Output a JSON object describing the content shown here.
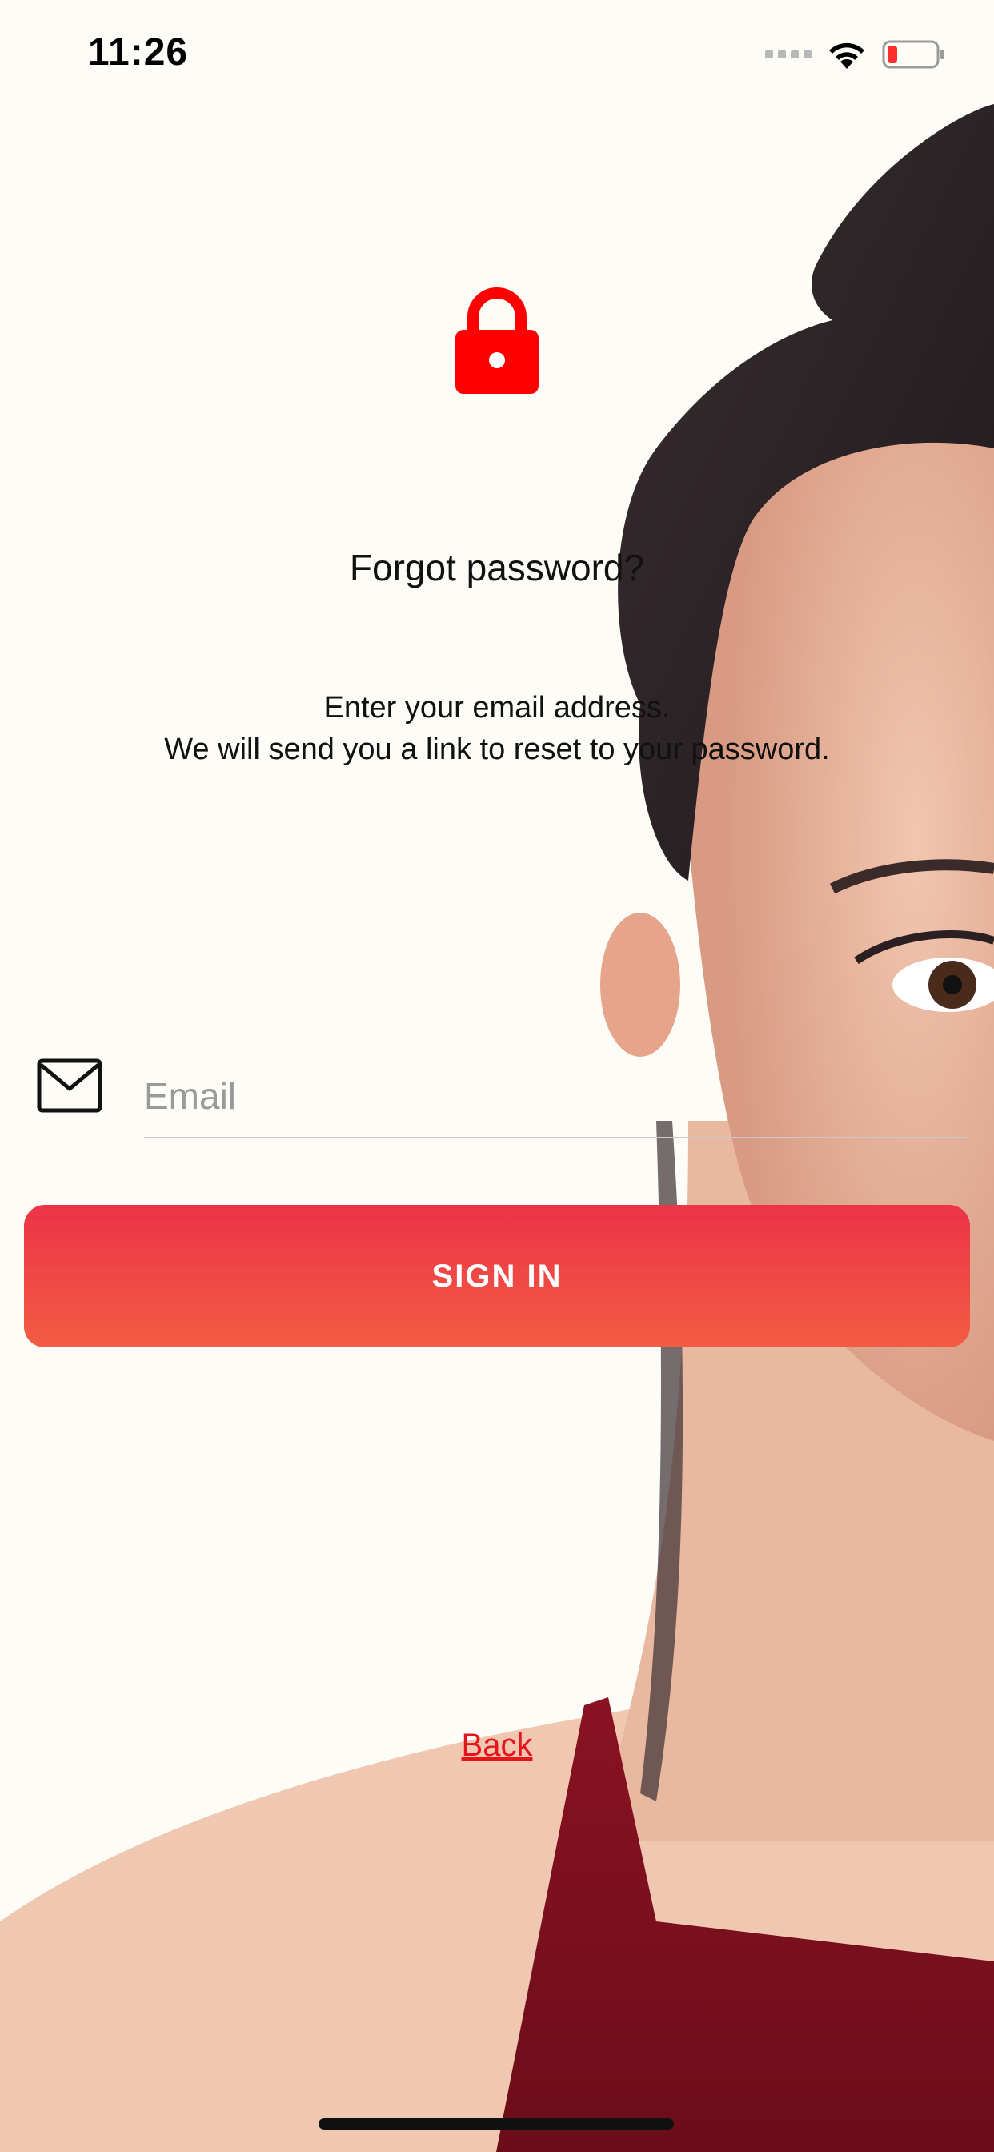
{
  "status_bar": {
    "time": "11:26",
    "icons": [
      "signal-icon",
      "wifi-icon",
      "battery-low-icon"
    ]
  },
  "lock_icon": {
    "name": "lock-icon",
    "color": "#ff0000"
  },
  "title": "Forgot password?",
  "description": {
    "line1": "Enter your email address.",
    "line2": "We will send you a link to reset to your password."
  },
  "email_field": {
    "icon": "mail-icon",
    "placeholder": "Email",
    "value": ""
  },
  "sign_in_button": {
    "label": "SIGN IN",
    "gradient_top": "#ec3347",
    "gradient_bottom": "#f25c44"
  },
  "back_link": {
    "label": "Back",
    "color": "#e8131b"
  }
}
